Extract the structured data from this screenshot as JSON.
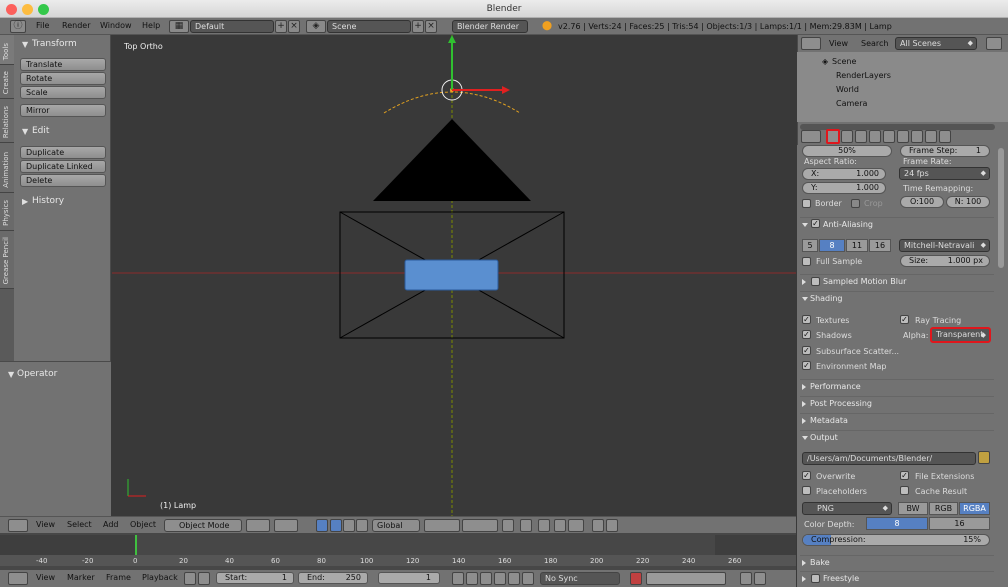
{
  "window": {
    "title": "Blender"
  },
  "topbar": {
    "menus": [
      "File",
      "Render",
      "Window",
      "Help"
    ],
    "screen_layout": "Default",
    "scene": "Scene",
    "engine": "Blender Render",
    "info": "v2.76 | Verts:24 | Faces:25 | Tris:54 | Objects:1/3 | Lamps:1/1 | Mem:29.83M | Lamp"
  },
  "toolshelf": {
    "tabs": [
      "Tools",
      "Create",
      "Relations",
      "Animation",
      "Physics",
      "Grease Pencil"
    ],
    "transform_header": "Transform",
    "transform_buttons": [
      "Translate",
      "Rotate",
      "Scale"
    ],
    "mirror": "Mirror",
    "edit_header": "Edit",
    "edit_buttons": [
      "Duplicate",
      "Duplicate Linked",
      "Delete"
    ],
    "history": "History",
    "operator": "Operator"
  },
  "viewport": {
    "view_label": "Top Ortho",
    "object_label": "(1) Lamp"
  },
  "viewport_header": {
    "menus": [
      "View",
      "Select",
      "Add",
      "Object"
    ],
    "mode": "Object Mode",
    "orientation": "Global"
  },
  "timeline": {
    "ticks": [
      "-40",
      "-20",
      "0",
      "20",
      "40",
      "60",
      "80",
      "100",
      "120",
      "140",
      "160",
      "180",
      "200",
      "220",
      "240",
      "260"
    ],
    "menus": [
      "View",
      "Marker",
      "Frame",
      "Playback"
    ],
    "start": "Start:",
    "start_value": "1",
    "end": "End:",
    "end_value": "250",
    "current": "1",
    "sync": "No Sync"
  },
  "outliner": {
    "menus": [
      "View",
      "Search"
    ],
    "filter": "All Scenes",
    "items": [
      "Scene",
      "RenderLayers",
      "World",
      "Camera"
    ]
  },
  "properties": {
    "frame_rate_pct": "50%",
    "frame_step": "Frame Step:",
    "frame_step_value": "1",
    "aspect_ratio": "Aspect Ratio:",
    "aspect_x": "X:",
    "aspect_x_value": "1.000",
    "aspect_y": "Y:",
    "aspect_y_value": "1.000",
    "frame_rate": "Frame Rate:",
    "fps": "24 fps",
    "time_remapping": "Time Remapping:",
    "remap_old": "O:100",
    "remap_new": "N: 100",
    "border": "Border",
    "crop": "Crop",
    "anti_aliasing": "Anti-Aliasing",
    "aa_levels": [
      "5",
      "8",
      "11",
      "16"
    ],
    "aa_active": "8",
    "filter": "Mitchell-Netravali",
    "full_sample": "Full Sample",
    "size": "Size:",
    "size_value": "1.000 px",
    "sampled_motion_blur": "Sampled Motion Blur",
    "shading": "Shading",
    "textures": "Textures",
    "ray_tracing": "Ray Tracing",
    "shadows": "Shadows",
    "alpha": "Alpha:",
    "alpha_value": "Transparent",
    "subsurface": "Subsurface Scatter...",
    "env_map": "Environment Map",
    "performance": "Performance",
    "post_processing": "Post Processing",
    "metadata": "Metadata",
    "output": "Output",
    "output_path": "/Users/am/Documents/Blender/",
    "overwrite": "Overwrite",
    "file_extensions": "File Extensions",
    "placeholders": "Placeholders",
    "cache_result": "Cache Result",
    "format": "PNG",
    "color_modes": [
      "BW",
      "RGB",
      "RGBA"
    ],
    "color_active": "RGBA",
    "color_depth": "Color Depth:",
    "depth_8": "8",
    "depth_16": "16",
    "compression": "Compression:",
    "compression_value": "15%",
    "bake": "Bake",
    "freestyle": "Freestyle"
  },
  "colors": {
    "accent": "#5680c2",
    "highlight": "#e0161c",
    "grid_x": "#9b2a2a",
    "grid_y": "#8aa000"
  }
}
